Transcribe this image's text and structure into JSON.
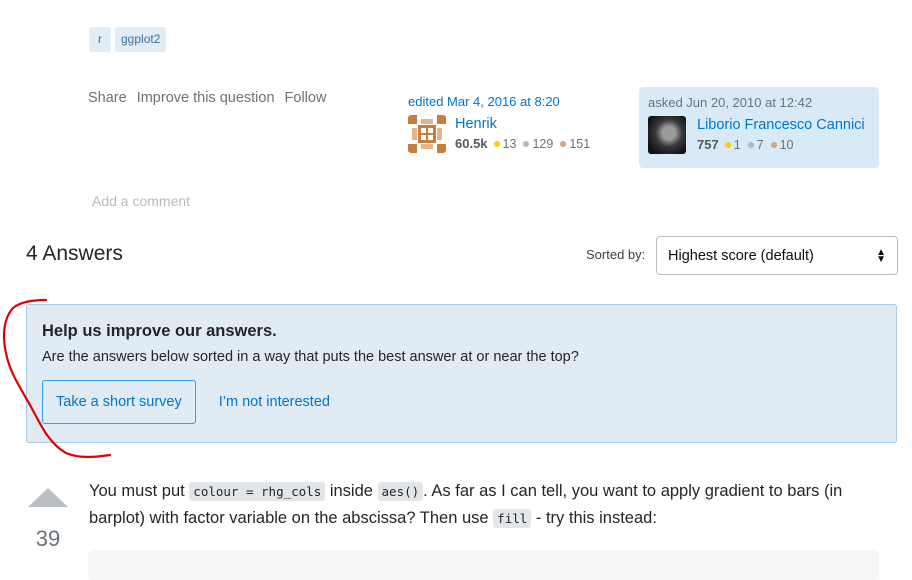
{
  "tags": [
    "r",
    "ggplot2"
  ],
  "post_menu": {
    "share": "Share",
    "improve": "Improve this question",
    "follow": "Follow"
  },
  "editor": {
    "action": "edited Mar 4, 2016 at 8:20",
    "name": "Henrik",
    "reputation": "60.5k",
    "gold": "13",
    "silver": "129",
    "bronze": "151",
    "avatar_color": "#c67e3f"
  },
  "asker": {
    "action": "asked Jun 20, 2010 at 12:42",
    "name": "Liborio Francesco Cannici",
    "reputation": "757",
    "gold": "1",
    "silver": "7",
    "bronze": "10"
  },
  "add_comment": "Add a comment",
  "answers": {
    "title": "4 Answers",
    "sorted_label": "Sorted by:",
    "sort_selected": "Highest score (default)"
  },
  "survey": {
    "heading": "Help us improve our answers.",
    "text": "Are the answers below sorted in a way that puts the best answer at or near the top?",
    "primary_button": "Take a short survey",
    "secondary_button": "I’m not interested"
  },
  "answer": {
    "score": "39",
    "segments": {
      "t1": "You must put ",
      "c1": "colour = rhg_cols",
      "t2": " inside ",
      "c2": "aes()",
      "t3": ". As far as I can tell, you want to apply gradient to bars (in barplot) with factor variable on the abscissa? Then use ",
      "c3": "fill",
      "t4": " - try this instead:"
    }
  },
  "colors": {
    "link": "#0074cc",
    "tag_bg": "#e1ecf4",
    "survey_bg": "#e1ebf4",
    "annotation": "#e00000"
  }
}
